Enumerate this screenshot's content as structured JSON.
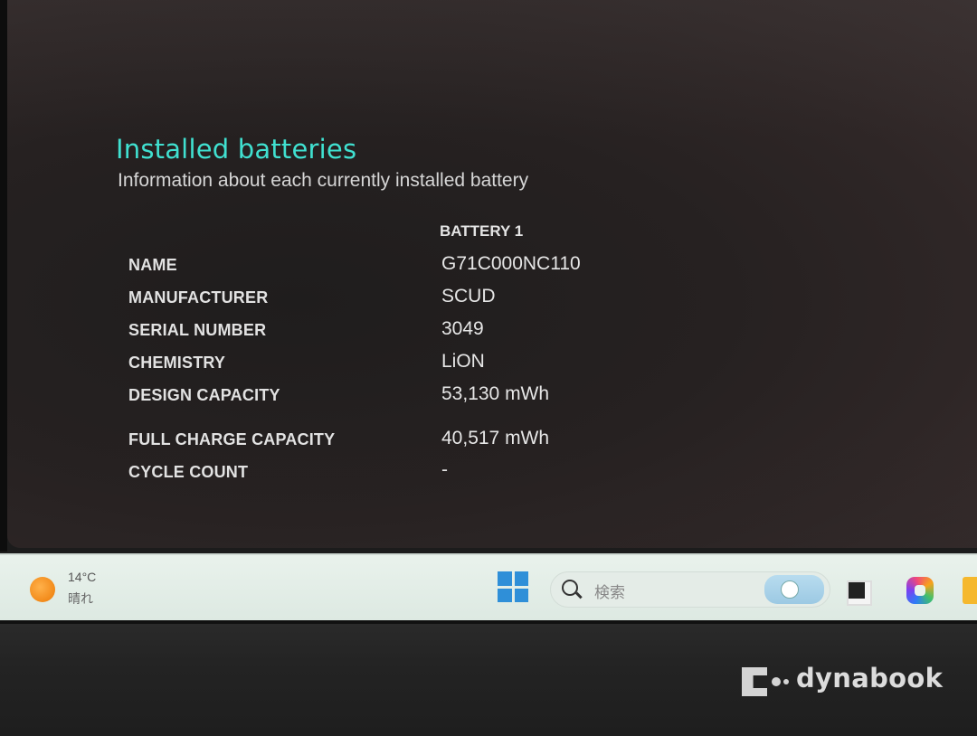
{
  "report": {
    "title": "Installed batteries",
    "subtitle": "Information about each currently installed battery",
    "column_header": "BATTERY 1",
    "rows": [
      {
        "label": "NAME",
        "value": "G71C000NC110"
      },
      {
        "label": "MANUFACTURER",
        "value": "SCUD"
      },
      {
        "label": "SERIAL NUMBER",
        "value": "3049"
      },
      {
        "label": "CHEMISTRY",
        "value": "LiON"
      },
      {
        "label": "DESIGN CAPACITY",
        "value": "53,130 mWh"
      },
      {
        "label": "FULL CHARGE CAPACITY",
        "value": "40,517 mWh"
      },
      {
        "label": "CYCLE COUNT",
        "value": "-"
      }
    ]
  },
  "taskbar": {
    "weather_temp": "14°C",
    "weather_condition": "晴れ",
    "search_placeholder": "検索",
    "icons": [
      "weather-sun-icon",
      "windows-start-icon",
      "search-icon",
      "task-view-icon",
      "copilot-icon",
      "file-explorer-icon"
    ]
  },
  "device": {
    "brand": "dynabook"
  },
  "colors": {
    "title": "#40e0d0",
    "screen_bg": "#242020",
    "taskbar_bg": "#e6efe9",
    "start_blue": "#2f8fd8"
  }
}
